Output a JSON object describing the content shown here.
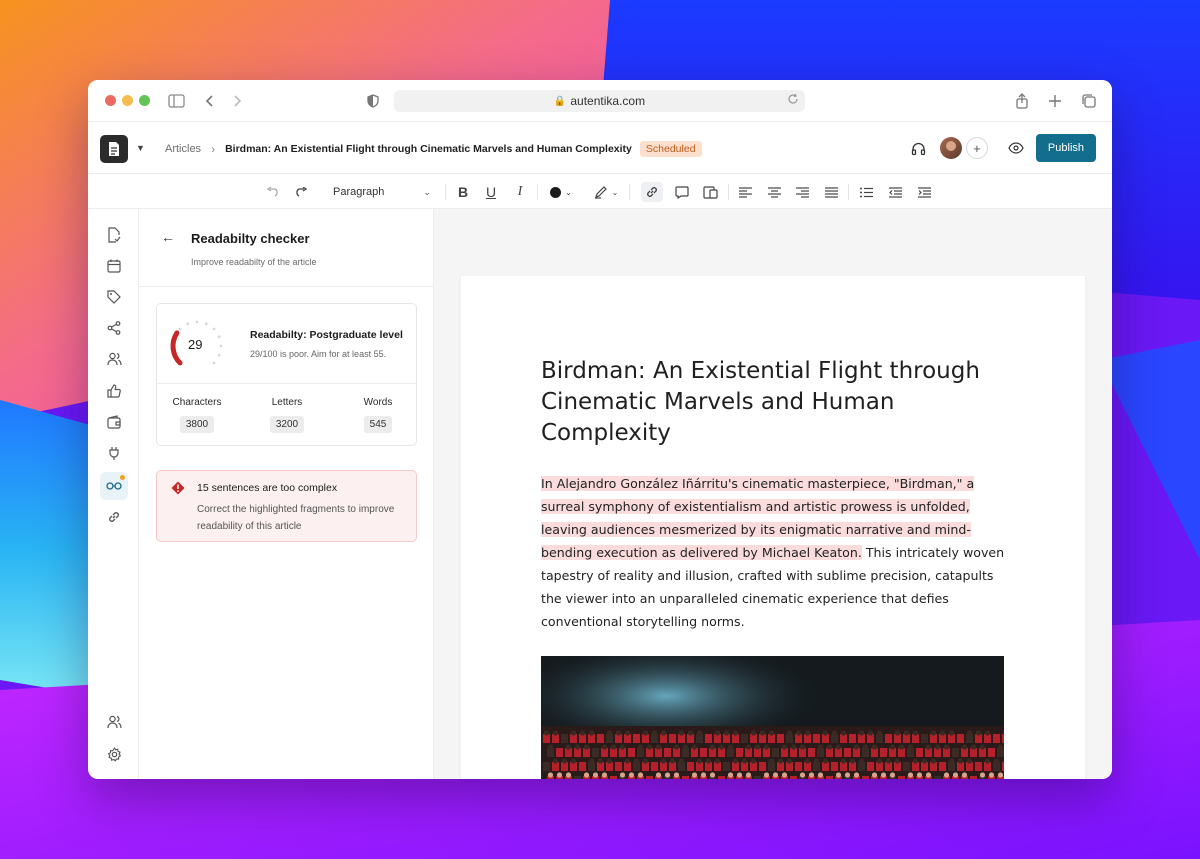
{
  "browser": {
    "url": "autentika.com"
  },
  "header": {
    "breadcrumb_root": "Articles",
    "article_title": "Birdman: An Existential Flight through Cinematic Marvels and Human Complexity",
    "status_badge": "Scheduled",
    "publish_label": "Publish"
  },
  "toolbar": {
    "block_style": "Paragraph"
  },
  "panel": {
    "title": "Readabilty checker",
    "subtitle": "Improve readabilty of the article",
    "score": "29",
    "score_fraction": 0.29,
    "level": "Readabilty: Postgraduate level",
    "note": "29/100 is poor. Aim for at least 55.",
    "stats": [
      {
        "label": "Characters",
        "value": "3800"
      },
      {
        "label": "Letters",
        "value": "3200"
      },
      {
        "label": "Words",
        "value": "545"
      }
    ],
    "alert_title": "15 sentences are too complex",
    "alert_body": "Correct the highlighted fragments to improve readability of this article"
  },
  "document": {
    "title": "Birdman: An Existential Flight through Cinematic Marvels and Human Complexity",
    "highlighted": "In Alejandro González Iñárritu's cinematic masterpiece, \"Birdman,\" a surreal symphony of existentialism and artistic prowess is unfolded, leaving audiences mesmerized by its enigmatic narrative and mind-bending execution as delivered by Michael Keaton.",
    "rest": " This intricately woven tapestry of reality and illusion, crafted with sublime precision, catapults the viewer into an unparalleled cinematic experience that defies conventional storytelling norms."
  },
  "colors": {
    "publish": "#136e8e",
    "badge_bg": "#fbe1cd",
    "highlight": "#fbdcdc",
    "gauge": "#c62828"
  }
}
